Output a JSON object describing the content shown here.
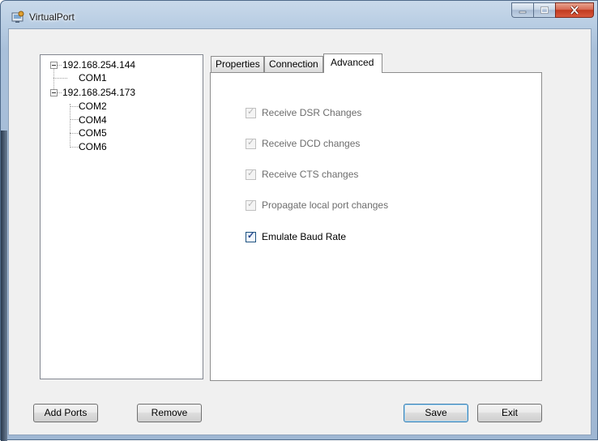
{
  "window": {
    "title": "VirtualPort"
  },
  "tree": {
    "nodes": [
      {
        "label": "192.168.254.144",
        "children": [
          "COM1"
        ]
      },
      {
        "label": "192.168.254.173",
        "children": [
          "COM2",
          "COM4",
          "COM5",
          "COM6"
        ]
      }
    ]
  },
  "tabs": [
    {
      "label": "Properties",
      "active": false
    },
    {
      "label": "Connection",
      "active": false
    },
    {
      "label": "Advanced",
      "active": true
    }
  ],
  "advanced": {
    "options": [
      {
        "label": "Receive DSR Changes",
        "checked": true,
        "enabled": false
      },
      {
        "label": "Receive DCD changes",
        "checked": true,
        "enabled": false
      },
      {
        "label": "Receive CTS changes",
        "checked": true,
        "enabled": false
      },
      {
        "label": "Propagate local port changes",
        "checked": true,
        "enabled": false
      },
      {
        "label": "Emulate Baud Rate",
        "checked": true,
        "enabled": true
      }
    ]
  },
  "buttons": {
    "add_ports": "Add Ports",
    "remove": "Remove",
    "save": "Save",
    "exit": "Exit"
  },
  "icons": {
    "app": "virtualport-app-icon",
    "minimize": "minimize-icon",
    "maximize": "maximize-icon",
    "close": "close-icon"
  }
}
